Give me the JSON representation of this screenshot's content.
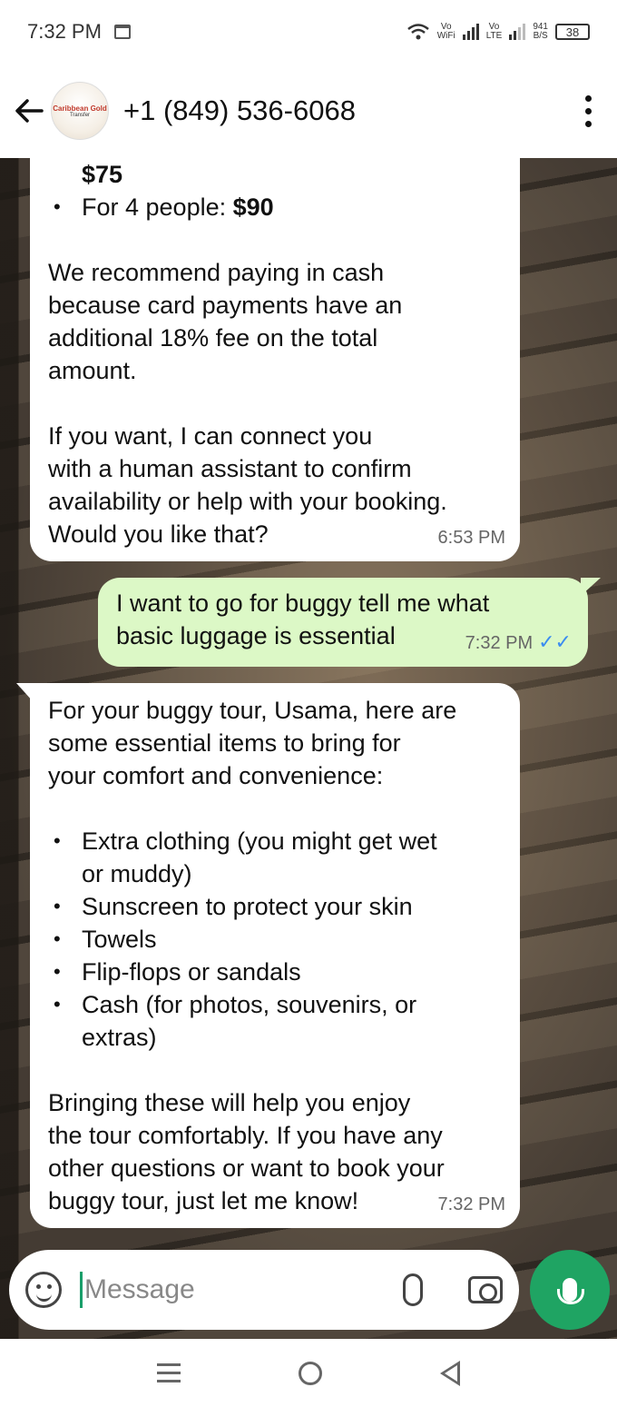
{
  "status_bar": {
    "time": "7:32 PM",
    "wifi_label_top": "Vo",
    "wifi_label_bottom": "WiFi",
    "lte_label_top": "Vo",
    "lte_label_bottom": "LTE",
    "speed_top": "941",
    "speed_bottom": "B/S",
    "battery": "38"
  },
  "header": {
    "contact": "+1 (849) 536-6068",
    "avatar_logo_line1": "Caribbean Gold",
    "avatar_logo_line2": "Transfer"
  },
  "messages": [
    {
      "sender": "incoming",
      "price_line": "$75",
      "bullet_prefix": "For 4 people: ",
      "bullet_value": "$90",
      "para1": [
        "We recommend paying in cash",
        "because card payments have an",
        "additional 18% fee on the total",
        "amount."
      ],
      "para2": [
        "If you want, I can connect you",
        "with a human assistant to confirm",
        "availability or help with your booking.",
        "Would you like that?"
      ],
      "time": "6:53 PM"
    },
    {
      "sender": "outgoing",
      "line1": "I want to go for buggy tell me what",
      "line2": "basic   luggage is essential",
      "time": "7:32 PM",
      "status": "✓✓"
    },
    {
      "sender": "incoming",
      "intro": [
        "For your buggy tour, Usama, here are",
        "some essential items to bring for",
        "your comfort and convenience:"
      ],
      "items": [
        [
          "Extra clothing (you might get wet",
          "or muddy)"
        ],
        [
          "Sunscreen to protect your skin"
        ],
        [
          "Towels"
        ],
        [
          "Flip-flops or sandals"
        ],
        [
          "Cash (for photos, souvenirs, or",
          "extras)"
        ]
      ],
      "outro": [
        "Bringing these will help you enjoy",
        "the tour comfortably. If you have any",
        "other questions or want to book your",
        "buggy tour, just let me know!"
      ],
      "time": "7:32 PM"
    }
  ],
  "input": {
    "placeholder": "Message"
  }
}
